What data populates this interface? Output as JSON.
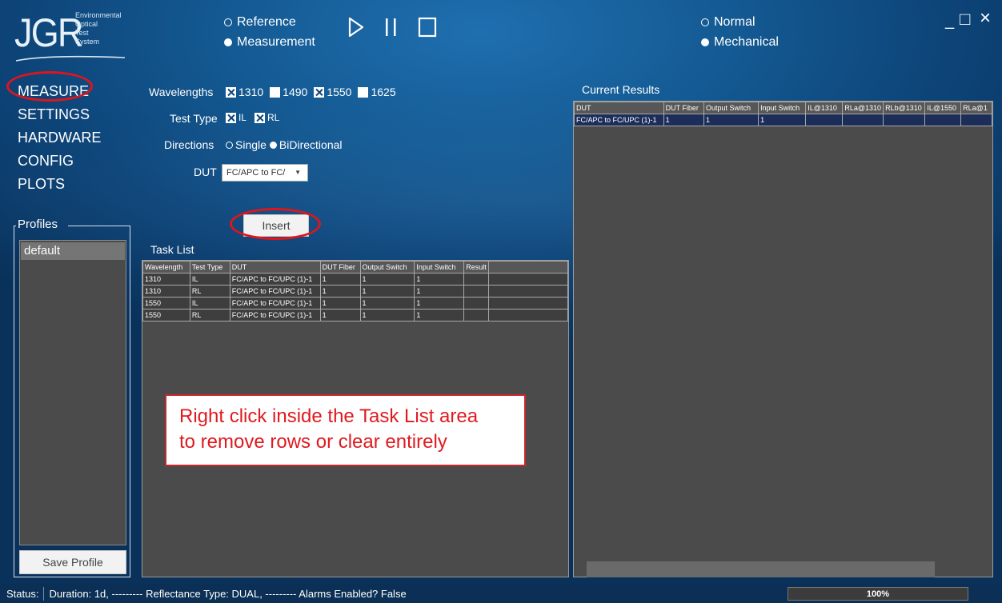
{
  "logo": {
    "letters": "JGR",
    "words": [
      "Environmental",
      "Optical",
      "Test",
      "System"
    ]
  },
  "top": {
    "mode_options": [
      {
        "label": "Reference",
        "selected": false
      },
      {
        "label": "Measurement",
        "selected": true
      }
    ],
    "test_options": [
      {
        "label": "Normal",
        "selected": false
      },
      {
        "label": "Mechanical",
        "selected": true
      }
    ],
    "transport_icons": [
      "play-icon",
      "pause-icon",
      "stop-icon"
    ],
    "window_controls": [
      "_",
      "□",
      "×"
    ]
  },
  "side_menu": [
    "MEASURE",
    "SETTINGS",
    "HARDWARE",
    "CONFIG",
    "PLOTS"
  ],
  "form": {
    "wavelengths_label": "Wavelengths",
    "wavelengths": [
      {
        "label": "1310",
        "checked": true
      },
      {
        "label": "1490",
        "checked": false
      },
      {
        "label": "1550",
        "checked": true
      },
      {
        "label": "1625",
        "checked": false
      }
    ],
    "test_type_label": "Test Type",
    "test_types": [
      {
        "label": "IL",
        "checked": true
      },
      {
        "label": "RL",
        "checked": true
      }
    ],
    "directions_label": "Directions",
    "directions": [
      {
        "label": "Single",
        "selected": false
      },
      {
        "label": "BiDirectional",
        "selected": true
      }
    ],
    "dut_label": "DUT",
    "dut_value": "FC/APC to FC/",
    "insert_label": "Insert"
  },
  "profiles": {
    "title": "Profiles",
    "items": [
      "default"
    ],
    "save_label": "Save Profile"
  },
  "task_list": {
    "title": "Task List",
    "columns": [
      "Wavelength",
      "Test Type",
      "DUT",
      "DUT Fiber",
      "Output Switch",
      "Input Switch",
      "Result"
    ],
    "rows": [
      [
        "1310",
        "IL",
        "FC/APC to FC/UPC (1)-1",
        "1",
        "1",
        "1",
        ""
      ],
      [
        "1310",
        "RL",
        "FC/APC to FC/UPC (1)-1",
        "1",
        "1",
        "1",
        ""
      ],
      [
        "1550",
        "IL",
        "FC/APC to FC/UPC (1)-1",
        "1",
        "1",
        "1",
        ""
      ],
      [
        "1550",
        "RL",
        "FC/APC to FC/UPC (1)-1",
        "1",
        "1",
        "1",
        ""
      ]
    ]
  },
  "current_results": {
    "title": "Current Results",
    "columns": [
      "DUT",
      "DUT Fiber",
      "Output Switch",
      "Input Switch",
      "IL@1310",
      "RLa@1310",
      "RLb@1310",
      "IL@1550",
      "RLa@1"
    ],
    "rows": [
      [
        "FC/APC to FC/UPC (1)-1",
        "1",
        "1",
        "1",
        "",
        "",
        "",
        "",
        ""
      ]
    ]
  },
  "annotation": {
    "line1": "Right click inside the Task List area",
    "line2": "to remove rows or clear entirely"
  },
  "status": {
    "label": "Status:",
    "text": "Duration: 1d, --------- Reflectance Type: DUAL, --------- Alarms Enabled? False",
    "progress_percent": 100,
    "progress_text": "100%"
  },
  "colors": {
    "highlight_ring": "#e0151b",
    "selected_row": "#1c2d5a",
    "grid_background": "#4b4b4b"
  }
}
